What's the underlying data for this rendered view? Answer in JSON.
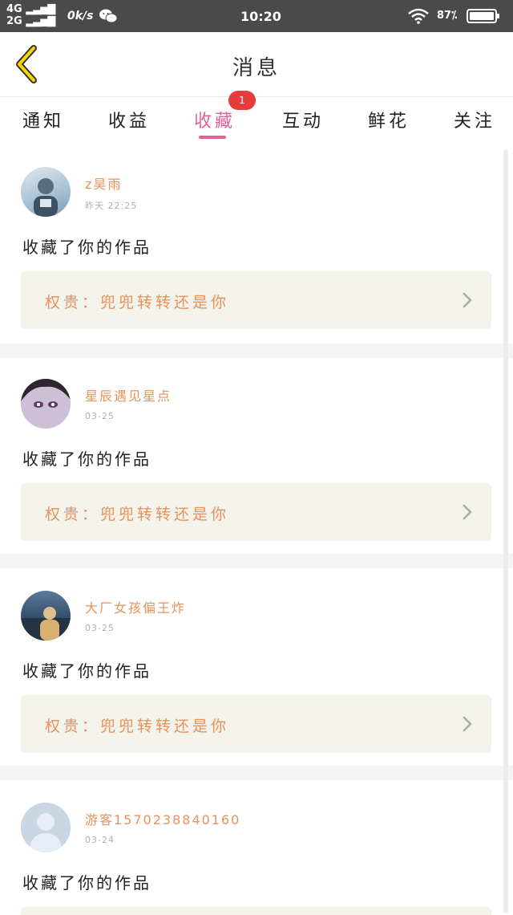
{
  "status_bar": {
    "network_top": "4G",
    "network_bottom": "2G",
    "net_speed": "0k/s",
    "time": "10:20",
    "battery": "87"
  },
  "header": {
    "title": "消息"
  },
  "tabs": [
    {
      "label": "通知"
    },
    {
      "label": "收益"
    },
    {
      "label": "收藏",
      "active": true,
      "badge": "1"
    },
    {
      "label": "互动"
    },
    {
      "label": "鲜花"
    },
    {
      "label": "关注"
    }
  ],
  "messages": [
    {
      "username": "z昊雨",
      "time": "昨天 22:25",
      "action": "收藏了你的作品",
      "work": "权贵：兜兜转转还是你"
    },
    {
      "username": "星辰遇见星点",
      "time": "03-25",
      "action": "收藏了你的作品",
      "work": "权贵：兜兜转转还是你"
    },
    {
      "username": "大厂女孩偏王炸",
      "time": "03-25",
      "action": "收藏了你的作品",
      "work": "权贵：兜兜转转还是你"
    },
    {
      "username": "游客1570238840160",
      "time": "03-24",
      "action": "收藏了你的作品"
    }
  ],
  "colors": {
    "accent": "#e8609a",
    "badge": "#e83b3b",
    "username": "#e8915a",
    "work_bg": "#f3f3ec",
    "statusbar": "#4a4a4a"
  }
}
